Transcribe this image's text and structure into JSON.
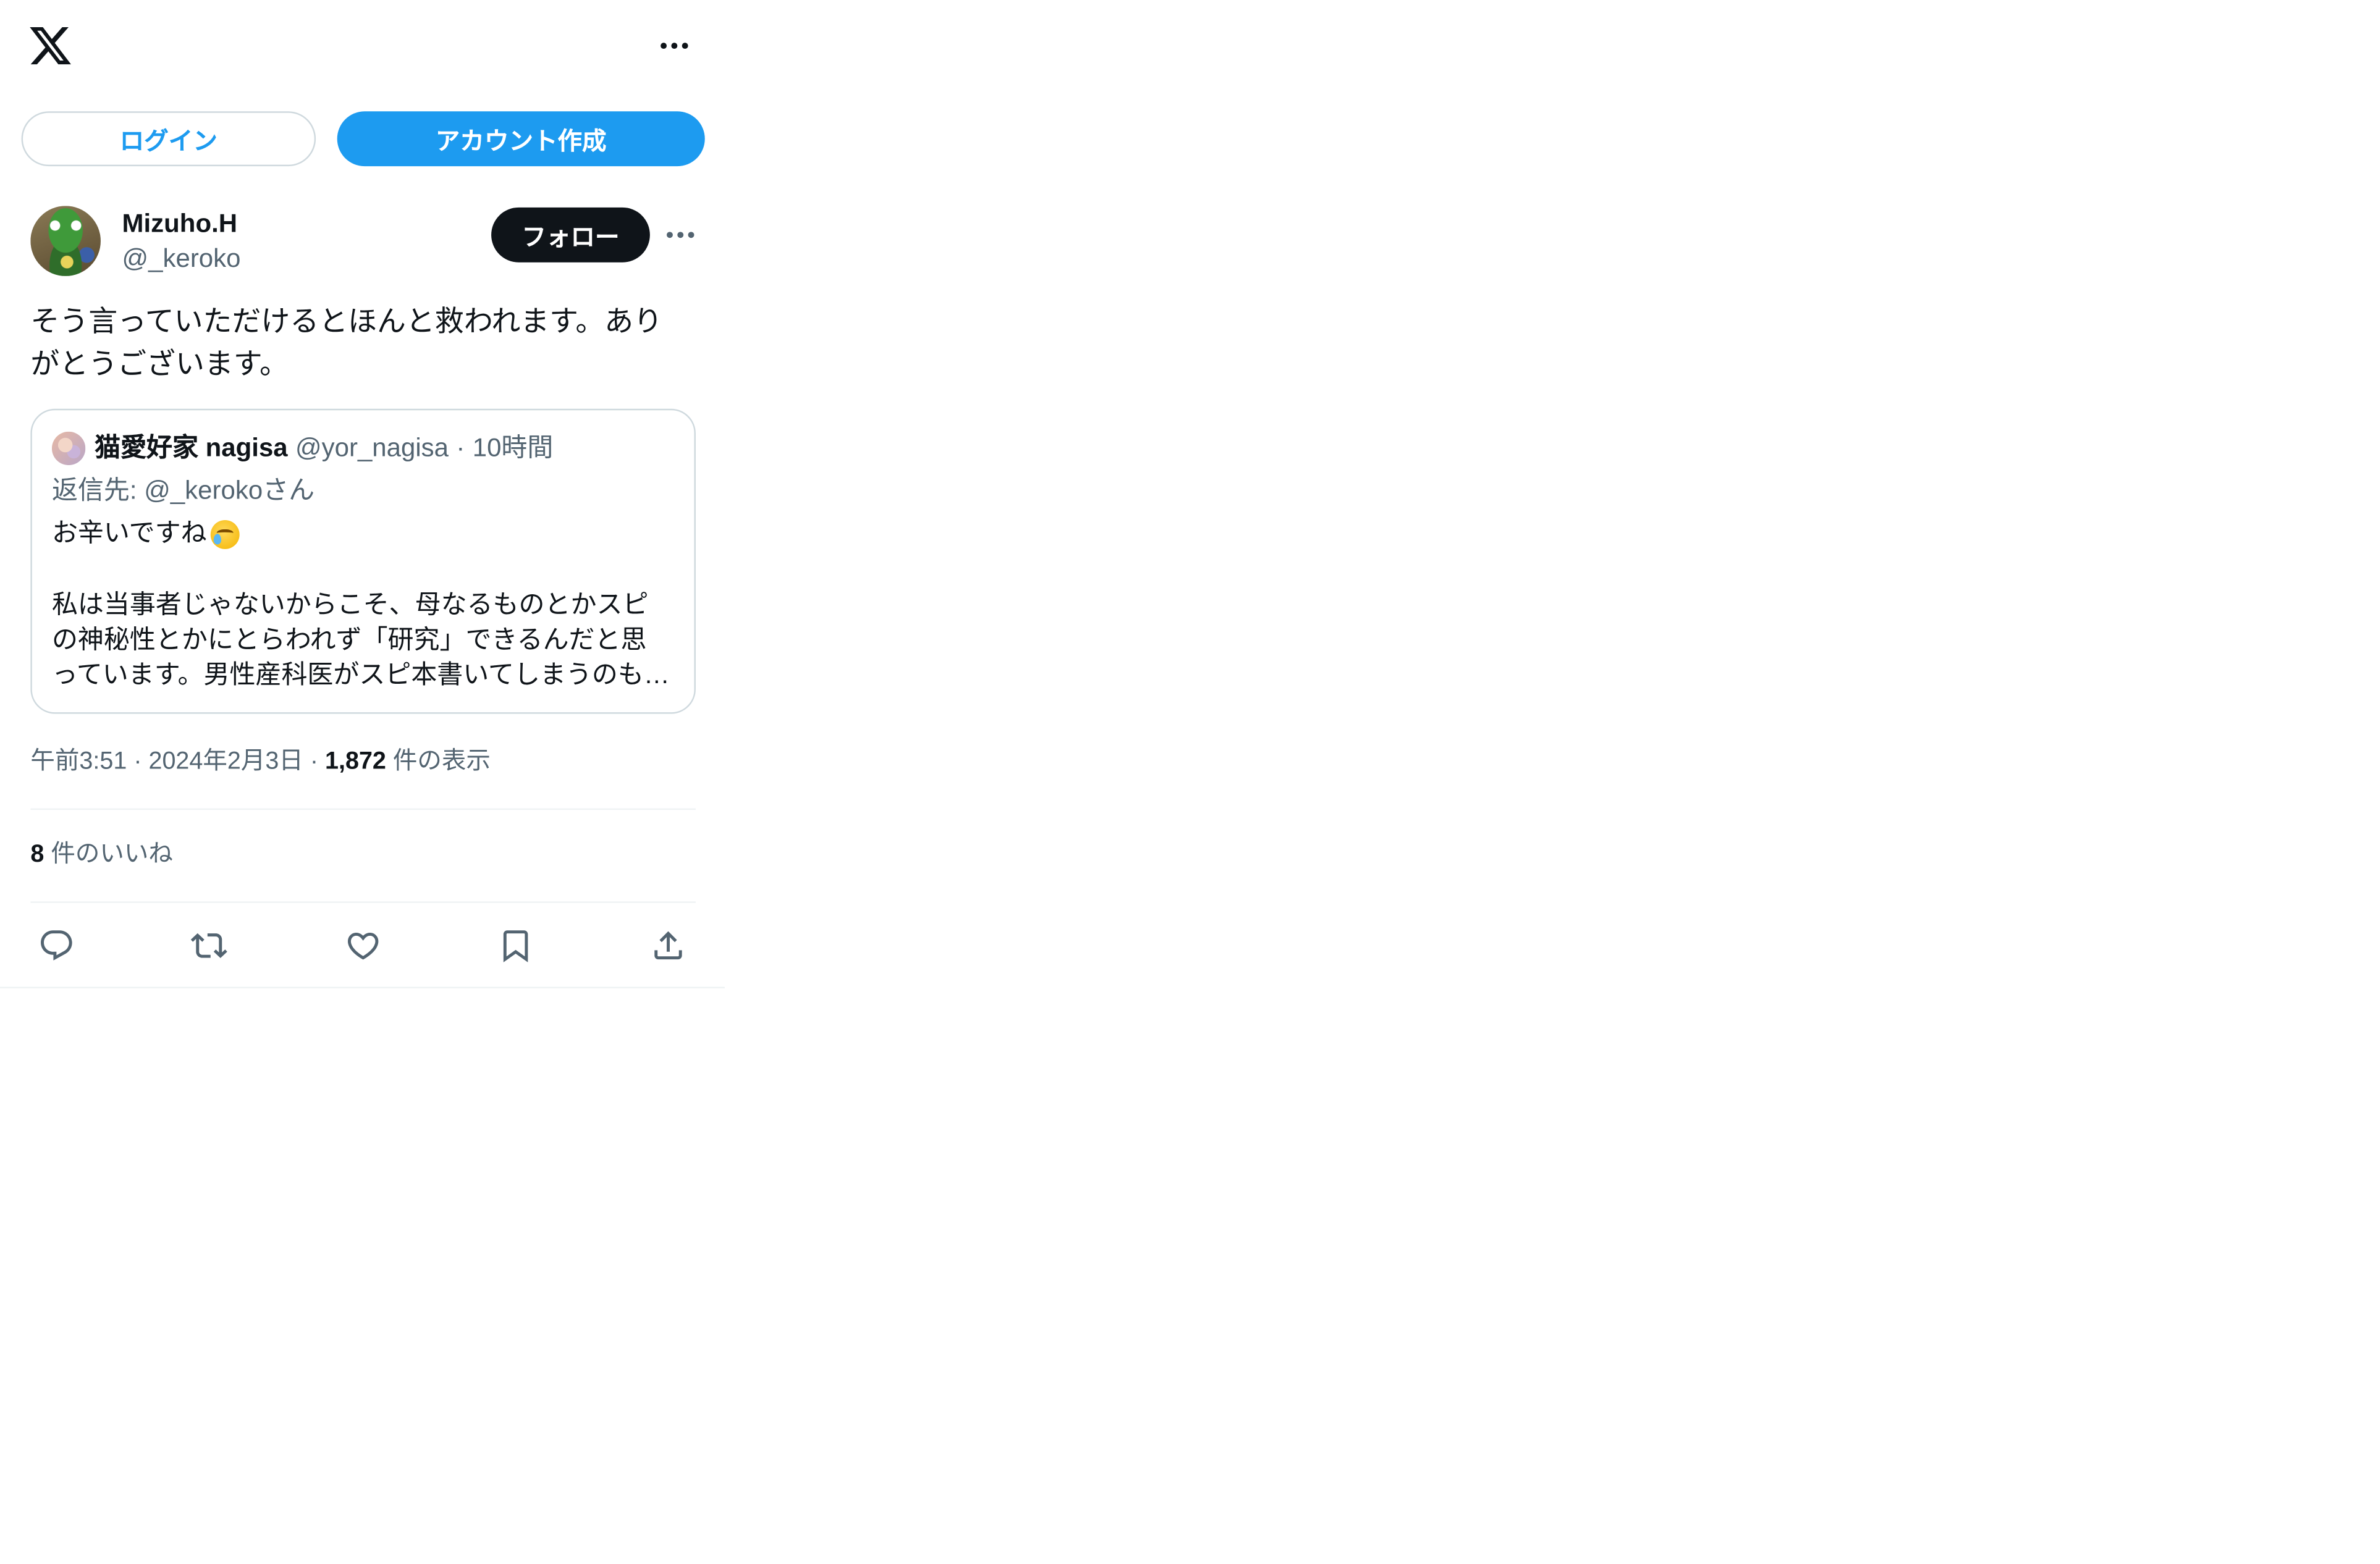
{
  "header": {
    "logo_icon": "x-logo-icon",
    "more_icon": "more-icon"
  },
  "auth": {
    "login_label": "ログイン",
    "signup_label": "アカウント作成"
  },
  "tweet": {
    "author": {
      "name": "Mizuho.H",
      "handle": "@_keroko",
      "avatar_icon": "avatar"
    },
    "follow_label": "フォロー",
    "more_icon": "more-icon",
    "text": "そう言っていただけるとほんと救われます。ありがとうございます。",
    "quote": {
      "author_name": "猫愛好家 nagisa",
      "handle": "@yor_nagisa",
      "separator": "·",
      "time": "10時間",
      "reply_to": "返信先: @_kerokoさん",
      "first_line": "お辛いですね",
      "emoji_icon": "crying-face-emoji-icon",
      "body_lines": [
        "私は当事者じゃないからこそ、母なるものとかスピ",
        "の神秘性とかにとらわれず「研究」できるんだと思",
        "っています。男性産科医がスピ本書いてしまうのも…"
      ]
    },
    "meta": {
      "time": "午前3:51",
      "separator": "·",
      "date": "2024年2月3日",
      "views": "1,872",
      "views_label": "件の表示"
    },
    "likes": {
      "count": "8",
      "label": "件のいいね"
    }
  },
  "actions": [
    "reply-icon",
    "retweet-icon",
    "like-icon",
    "bookmark-icon",
    "share-icon"
  ],
  "colors": {
    "accent": "#1d9bf0",
    "text": "#0f1419",
    "secondary": "#536471",
    "border": "#cfd9de",
    "divider": "#eff3f4",
    "follow_button": "#0f1419"
  }
}
